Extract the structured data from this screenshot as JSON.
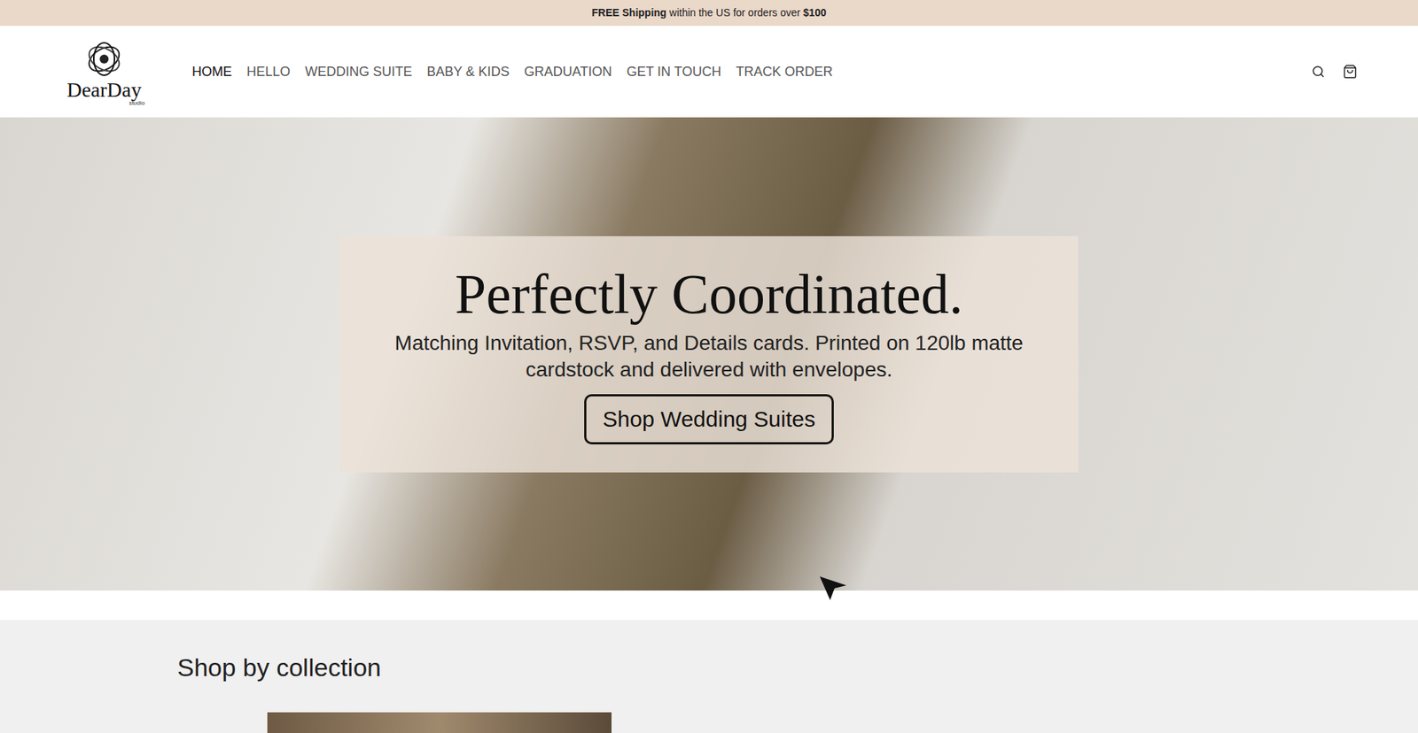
{
  "announcement": {
    "parts": [
      {
        "text": "FREE Shipping",
        "bold": true
      },
      {
        "text": " within the US for orders over ",
        "bold": false
      },
      {
        "text": "$100",
        "bold": true
      }
    ]
  },
  "logo": {
    "name": "DearDay",
    "sub": "studio"
  },
  "nav": [
    {
      "label": "HOME",
      "selected": true
    },
    {
      "label": "HELLO",
      "selected": false
    },
    {
      "label": "WEDDING SUITE",
      "selected": false
    },
    {
      "label": "BABY & KIDS",
      "selected": false
    },
    {
      "label": "GRADUATION",
      "selected": false
    },
    {
      "label": "GET IN TOUCH",
      "selected": false
    },
    {
      "label": "TRACK ORDER",
      "selected": false
    }
  ],
  "hero": {
    "heading": "Perfectly Coordinated.",
    "subheading": "Matching Invitation, RSVP, and Details cards. Printed on 120lb matte cardstock and delivered with envelopes.",
    "button": "Shop Wedding Suites"
  },
  "collections": {
    "title": "Shop by collection"
  }
}
